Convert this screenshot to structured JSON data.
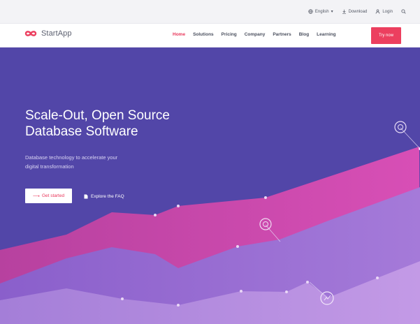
{
  "topbar": {
    "language_label": "English",
    "download_label": "Download",
    "login_label": "Login"
  },
  "brand": {
    "name": "StartApp",
    "accent": "#ec3f5f"
  },
  "nav": {
    "items": [
      {
        "label": "Home",
        "active": true
      },
      {
        "label": "Solutions"
      },
      {
        "label": "Pricing"
      },
      {
        "label": "Company"
      },
      {
        "label": "Partners"
      },
      {
        "label": "Blog"
      },
      {
        "label": "Learning"
      }
    ],
    "try_label": "Try now"
  },
  "hero": {
    "headline_line1": "Scale-Out, Open Source",
    "headline_line2": "Database Software",
    "sub_line1": "Database technology to accelerate your",
    "sub_line2": "digital transformation",
    "primary_label": "Get started",
    "secondary_label": "Explore the FAQ",
    "background": "#5246a8",
    "band_pink": "#c94ab0",
    "band_violet": "#9a6fd6",
    "band_lilac": "#b98ce0"
  },
  "icons": {
    "language": "globe-icon",
    "download": "download-icon",
    "login": "user-icon",
    "search": "search-icon",
    "brand": "infinity-logo-icon",
    "primary": "arrow-icon",
    "secondary": "document-icon"
  }
}
